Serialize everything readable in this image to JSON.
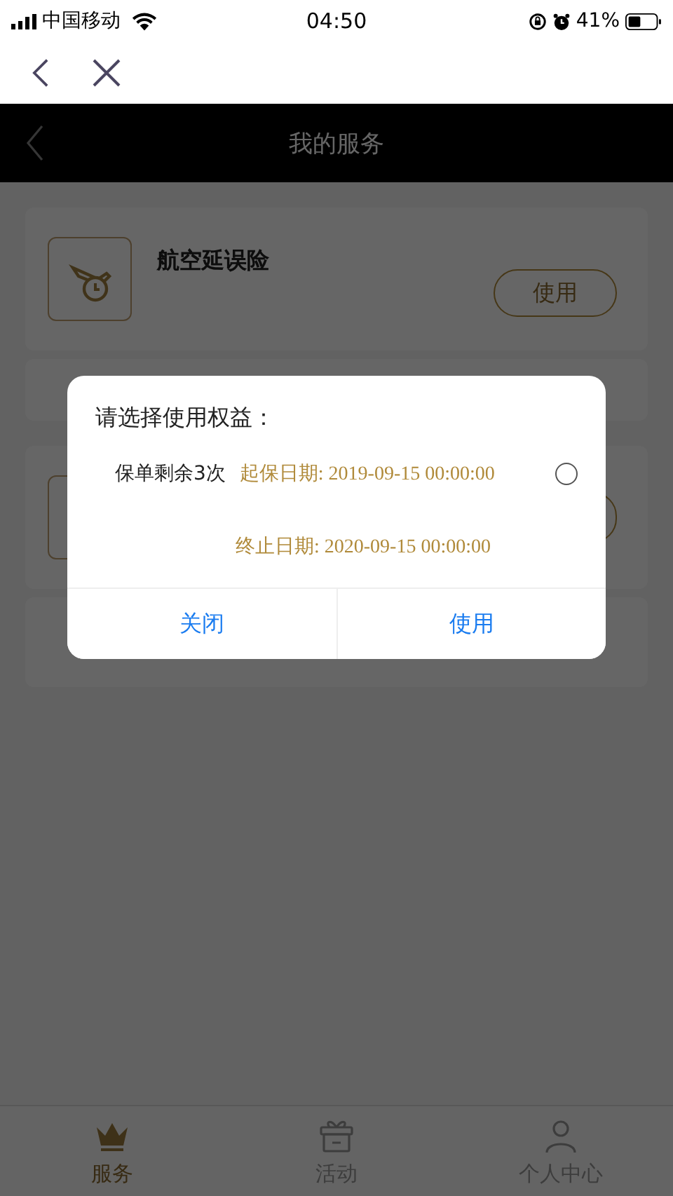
{
  "status_bar": {
    "carrier": "中国移动",
    "time": "04:50",
    "battery": "41%"
  },
  "header": {
    "title": "我的服务"
  },
  "services": [
    {
      "name": "航空延误险",
      "button": "使用"
    }
  ],
  "dialog": {
    "title": "请选择使用权益：",
    "options": [
      {
        "remaining": "保单剩余3次",
        "start": "起保日期: 2019-09-15 00:00:00",
        "end": "终止日期:  2020-09-15 00:00:00",
        "selected": false
      }
    ],
    "buttons": [
      "关闭",
      "使用"
    ]
  },
  "tabs": [
    {
      "label": "服务",
      "selected": true
    },
    {
      "label": "活动",
      "selected": false
    },
    {
      "label": "个人中心",
      "selected": false
    }
  ]
}
